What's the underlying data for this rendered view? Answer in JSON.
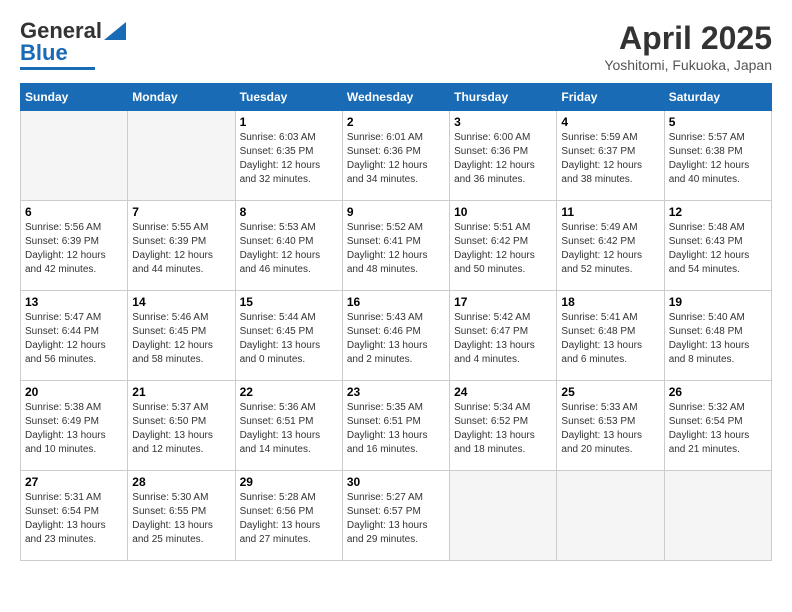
{
  "header": {
    "logo_line1": "General",
    "logo_line2": "Blue",
    "month_year": "April 2025",
    "location": "Yoshitomi, Fukuoka, Japan"
  },
  "days_of_week": [
    "Sunday",
    "Monday",
    "Tuesday",
    "Wednesday",
    "Thursday",
    "Friday",
    "Saturday"
  ],
  "weeks": [
    [
      {
        "day": "",
        "empty": true
      },
      {
        "day": "",
        "empty": true
      },
      {
        "day": "1",
        "sunrise": "Sunrise: 6:03 AM",
        "sunset": "Sunset: 6:35 PM",
        "daylight": "Daylight: 12 hours and 32 minutes."
      },
      {
        "day": "2",
        "sunrise": "Sunrise: 6:01 AM",
        "sunset": "Sunset: 6:36 PM",
        "daylight": "Daylight: 12 hours and 34 minutes."
      },
      {
        "day": "3",
        "sunrise": "Sunrise: 6:00 AM",
        "sunset": "Sunset: 6:36 PM",
        "daylight": "Daylight: 12 hours and 36 minutes."
      },
      {
        "day": "4",
        "sunrise": "Sunrise: 5:59 AM",
        "sunset": "Sunset: 6:37 PM",
        "daylight": "Daylight: 12 hours and 38 minutes."
      },
      {
        "day": "5",
        "sunrise": "Sunrise: 5:57 AM",
        "sunset": "Sunset: 6:38 PM",
        "daylight": "Daylight: 12 hours and 40 minutes."
      }
    ],
    [
      {
        "day": "6",
        "sunrise": "Sunrise: 5:56 AM",
        "sunset": "Sunset: 6:39 PM",
        "daylight": "Daylight: 12 hours and 42 minutes."
      },
      {
        "day": "7",
        "sunrise": "Sunrise: 5:55 AM",
        "sunset": "Sunset: 6:39 PM",
        "daylight": "Daylight: 12 hours and 44 minutes."
      },
      {
        "day": "8",
        "sunrise": "Sunrise: 5:53 AM",
        "sunset": "Sunset: 6:40 PM",
        "daylight": "Daylight: 12 hours and 46 minutes."
      },
      {
        "day": "9",
        "sunrise": "Sunrise: 5:52 AM",
        "sunset": "Sunset: 6:41 PM",
        "daylight": "Daylight: 12 hours and 48 minutes."
      },
      {
        "day": "10",
        "sunrise": "Sunrise: 5:51 AM",
        "sunset": "Sunset: 6:42 PM",
        "daylight": "Daylight: 12 hours and 50 minutes."
      },
      {
        "day": "11",
        "sunrise": "Sunrise: 5:49 AM",
        "sunset": "Sunset: 6:42 PM",
        "daylight": "Daylight: 12 hours and 52 minutes."
      },
      {
        "day": "12",
        "sunrise": "Sunrise: 5:48 AM",
        "sunset": "Sunset: 6:43 PM",
        "daylight": "Daylight: 12 hours and 54 minutes."
      }
    ],
    [
      {
        "day": "13",
        "sunrise": "Sunrise: 5:47 AM",
        "sunset": "Sunset: 6:44 PM",
        "daylight": "Daylight: 12 hours and 56 minutes."
      },
      {
        "day": "14",
        "sunrise": "Sunrise: 5:46 AM",
        "sunset": "Sunset: 6:45 PM",
        "daylight": "Daylight: 12 hours and 58 minutes."
      },
      {
        "day": "15",
        "sunrise": "Sunrise: 5:44 AM",
        "sunset": "Sunset: 6:45 PM",
        "daylight": "Daylight: 13 hours and 0 minutes."
      },
      {
        "day": "16",
        "sunrise": "Sunrise: 5:43 AM",
        "sunset": "Sunset: 6:46 PM",
        "daylight": "Daylight: 13 hours and 2 minutes."
      },
      {
        "day": "17",
        "sunrise": "Sunrise: 5:42 AM",
        "sunset": "Sunset: 6:47 PM",
        "daylight": "Daylight: 13 hours and 4 minutes."
      },
      {
        "day": "18",
        "sunrise": "Sunrise: 5:41 AM",
        "sunset": "Sunset: 6:48 PM",
        "daylight": "Daylight: 13 hours and 6 minutes."
      },
      {
        "day": "19",
        "sunrise": "Sunrise: 5:40 AM",
        "sunset": "Sunset: 6:48 PM",
        "daylight": "Daylight: 13 hours and 8 minutes."
      }
    ],
    [
      {
        "day": "20",
        "sunrise": "Sunrise: 5:38 AM",
        "sunset": "Sunset: 6:49 PM",
        "daylight": "Daylight: 13 hours and 10 minutes."
      },
      {
        "day": "21",
        "sunrise": "Sunrise: 5:37 AM",
        "sunset": "Sunset: 6:50 PM",
        "daylight": "Daylight: 13 hours and 12 minutes."
      },
      {
        "day": "22",
        "sunrise": "Sunrise: 5:36 AM",
        "sunset": "Sunset: 6:51 PM",
        "daylight": "Daylight: 13 hours and 14 minutes."
      },
      {
        "day": "23",
        "sunrise": "Sunrise: 5:35 AM",
        "sunset": "Sunset: 6:51 PM",
        "daylight": "Daylight: 13 hours and 16 minutes."
      },
      {
        "day": "24",
        "sunrise": "Sunrise: 5:34 AM",
        "sunset": "Sunset: 6:52 PM",
        "daylight": "Daylight: 13 hours and 18 minutes."
      },
      {
        "day": "25",
        "sunrise": "Sunrise: 5:33 AM",
        "sunset": "Sunset: 6:53 PM",
        "daylight": "Daylight: 13 hours and 20 minutes."
      },
      {
        "day": "26",
        "sunrise": "Sunrise: 5:32 AM",
        "sunset": "Sunset: 6:54 PM",
        "daylight": "Daylight: 13 hours and 21 minutes."
      }
    ],
    [
      {
        "day": "27",
        "sunrise": "Sunrise: 5:31 AM",
        "sunset": "Sunset: 6:54 PM",
        "daylight": "Daylight: 13 hours and 23 minutes."
      },
      {
        "day": "28",
        "sunrise": "Sunrise: 5:30 AM",
        "sunset": "Sunset: 6:55 PM",
        "daylight": "Daylight: 13 hours and 25 minutes."
      },
      {
        "day": "29",
        "sunrise": "Sunrise: 5:28 AM",
        "sunset": "Sunset: 6:56 PM",
        "daylight": "Daylight: 13 hours and 27 minutes."
      },
      {
        "day": "30",
        "sunrise": "Sunrise: 5:27 AM",
        "sunset": "Sunset: 6:57 PM",
        "daylight": "Daylight: 13 hours and 29 minutes."
      },
      {
        "day": "",
        "empty": true
      },
      {
        "day": "",
        "empty": true
      },
      {
        "day": "",
        "empty": true
      }
    ]
  ]
}
